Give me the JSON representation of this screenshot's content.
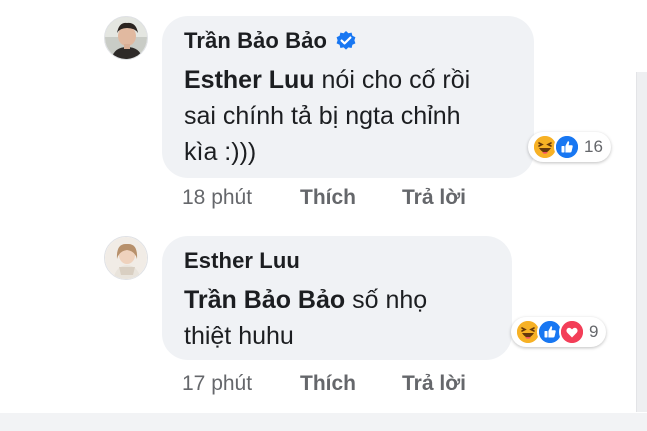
{
  "comments": [
    {
      "author": "Trần Bảo Bảo",
      "verified": true,
      "mention": "Esther Luu",
      "text_after_mention": " nói cho cố rồi sai chính tả bị ngta chỉnh kìa :)))",
      "line1_rest": " nói cho cố rồi",
      "line2": "sai chính tả bị ngta chỉnh",
      "line3": "kìa :)))",
      "reactions": [
        "haha",
        "like"
      ],
      "reaction_count": "16",
      "time": "18 phút",
      "like_label": "Thích",
      "reply_label": "Trả lời"
    },
    {
      "author": "Esther Luu",
      "verified": false,
      "mention": "Trần Bảo Bảo",
      "line1_rest": " số nhọ",
      "line2": "thiệt huhu",
      "reactions": [
        "haha",
        "like",
        "love"
      ],
      "reaction_count": "9",
      "time": "17 phút",
      "like_label": "Thích",
      "reply_label": "Trả lời"
    }
  ],
  "colors": {
    "bubble": "#f0f2f5",
    "text": "#1c1e21",
    "meta": "#65676b",
    "like_blue": "#1877f2",
    "love_red": "#f33e58",
    "haha_yellow": "#f7b125"
  },
  "icons": {
    "verified": "verified-badge-icon",
    "haha": "haha-reaction-icon",
    "like": "like-reaction-icon",
    "love": "love-reaction-icon"
  }
}
